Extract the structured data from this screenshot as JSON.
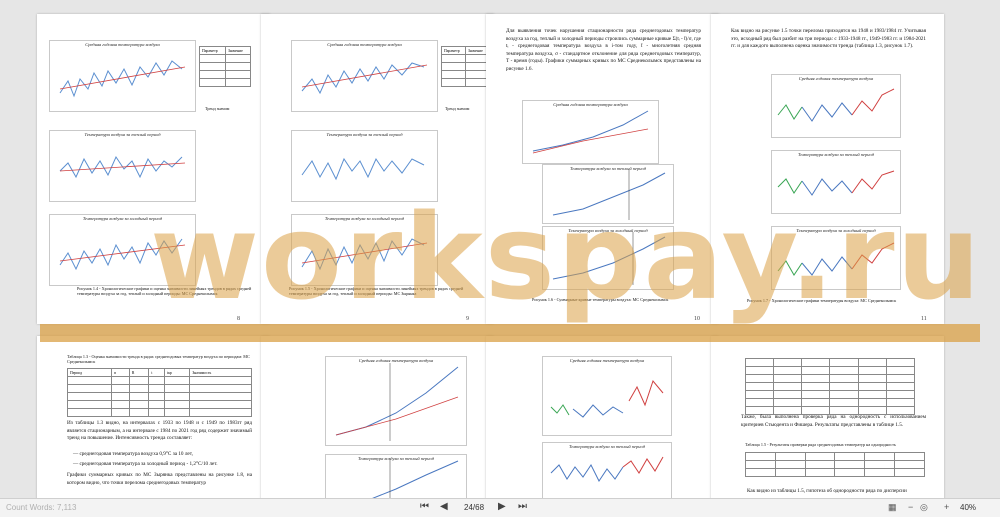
{
  "watermark": "workspay.ru",
  "status": {
    "left_text": "Count Words: 7,113",
    "page_indicator": "24/68",
    "zoom": "40%",
    "prev_symbol": "◀",
    "next_symbol": "▶",
    "first_symbol": "⏮",
    "last_symbol": "⏭",
    "minus_symbol": "−",
    "plus_symbol": "+"
  },
  "pages": {
    "p1": {
      "chart_titles": [
        "Средняя годовая температура воздуха",
        "Температура воздуха за теплый период",
        "Температура воздуха за холодный период"
      ],
      "param_header": [
        "Параметр",
        "Значение"
      ],
      "trend_label": "Тренд значим",
      "caption": "Рисунок 1.4 - Хронологические графики и оценка значимости линейных трендов в рядах средней температуры воздуха за год, теплый и холодный периоды: МС Среднеколымск",
      "page_number": "8"
    },
    "p2": {
      "chart_titles": [
        "Средняя годовая температура воздуха",
        "Температура воздуха за теплый период",
        "Температура воздуха за холодный период"
      ],
      "param_header": [
        "Параметр",
        "Значение"
      ],
      "trend_label": "Тренд значим",
      "caption": "Рисунок 1.5 - Хронологические графики и оценка значимости линейных трендов в рядах средней температуры воздуха за год, теплый и холодный периоды: МС Зырянка",
      "page_number": "9"
    },
    "p3": {
      "text": "Для выявления точек нарушения стационарности ряда среднегодовых температур воздуха за год, теплый и холодный периоды строились суммарные кривые Σ(tᵢ - t̄)/σ, где tᵢ - среднегодовая температура воздуха в i-том году, t̄ - многолетняя средняя температура воздуха, σ - стандартное отклонение для ряда среднегодовых температур, T - время (годы). Графики суммарных кривых по МС Среднеколымск представлены на рисунке 1.6.",
      "chart_titles": [
        "Средняя годовая температура воздуха",
        "Температура воздуха за теплый период",
        "Температура воздуха за холодный период"
      ],
      "caption": "Рисунок 1.6 - Суммарные кривые температуры воздуха: МС Среднеколымск",
      "page_number": "10"
    },
    "p4": {
      "text": "Как видно на рисунке 1.5 точки перелома приходятся на 1948 и 1983/1984 гг. Учитывая это, исходный ряд был разбит на три периода: с 1933-1948 гг., 1949-1983 гг. и 1984-2021 гг. и для каждого выполнена оценка значимости тренда (таблица 1.3, рисунок 1.7).",
      "chart_titles": [
        "Средняя годовая температура воздуха",
        "Температура воздуха за теплый период",
        "Температура воздуха за холодный период"
      ],
      "caption": "Рисунок 1.7 - Хронологические графики температуры воздуха: МС Среднеколымск",
      "page_number": "11"
    },
    "p5": {
      "table_title": "Таблица 1.3 - Оценка значимости тренда в рядах среднегодовых температур воздуха по периодам: МС Среднеколымск",
      "table_header": [
        "Период",
        "n",
        "R",
        "t",
        "tкр",
        "Значимость"
      ],
      "text_lines": [
        "Из таблицы 1.3 видно, на интервалах с 1933 по 1948 и с 1949 по 1983гг ряд является стационарным, а на интервале с 1984 по 2021 год ряд содержит значимый тренд на повышение. Интенсивность тренда составляет:",
        "— среднегодовая температура воздуха 0,9°С за 10 лет,",
        "— среднегодовая температура за холодный период - 1,2°С/10 лет.",
        "Графики суммарных кривых по МС Зырянка представлены на рисунке 1.8, на котором видно, что точки перелома среднегодовых температур"
      ],
      "page_number": ""
    },
    "p6": {
      "chart_titles": [
        "Средняя годовая температура воздуха",
        "Температура воздуха за теплый период"
      ],
      "page_number": ""
    },
    "p7": {
      "chart_titles": [
        "Средняя годовая температура воздуха",
        "Температура воздуха за теплый период"
      ],
      "page_number": ""
    },
    "p8": {
      "text": "Также, была выполнена проверка ряда на однородность с использованием критериев Стьюдента и Фишера. Результаты представлены в таблице 1.5.",
      "table_title": "Таблица 1.5 - Результаты проверки ряда среднегодовых температур на однородность",
      "footer_text": "Как видно из таблицы 1.5, гипотеза об однородности ряда по дисперсии",
      "page_number": ""
    }
  }
}
